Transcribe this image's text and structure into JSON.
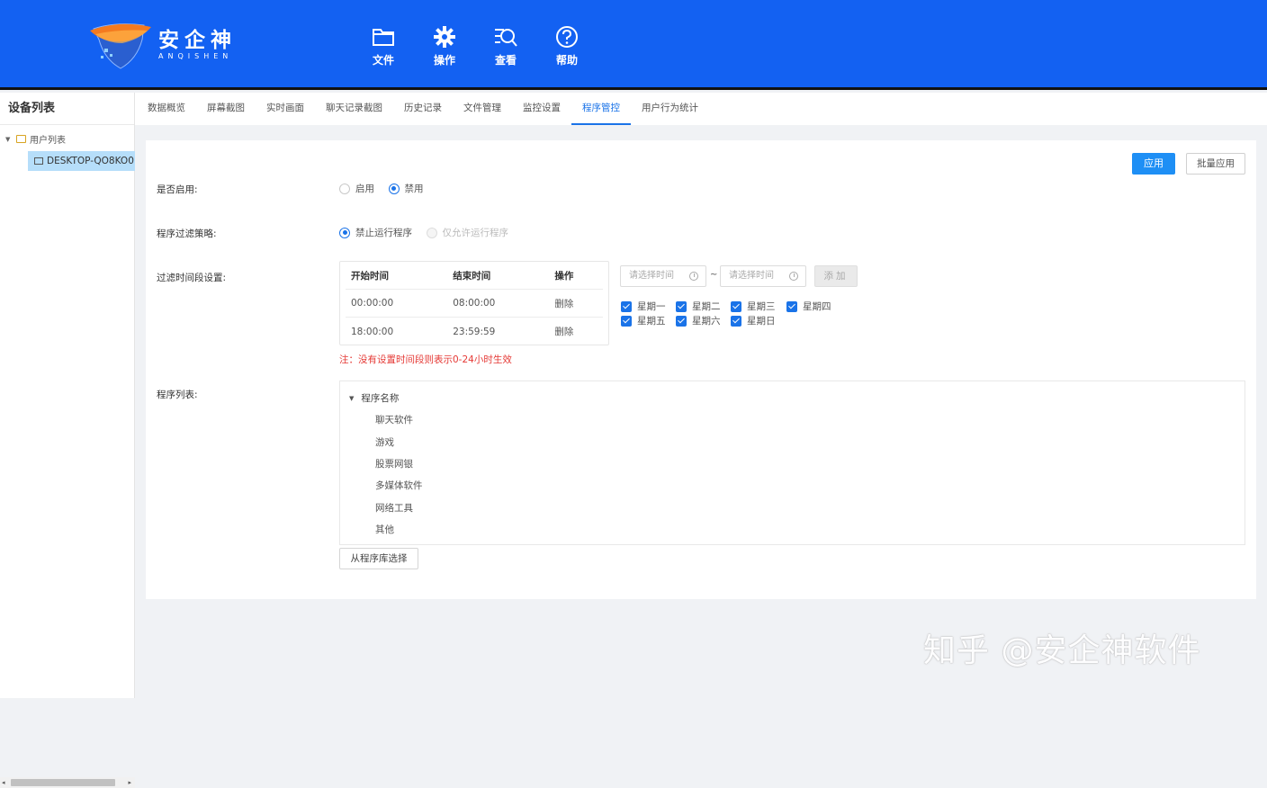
{
  "brand": {
    "name_cn": "安企神",
    "name_en": "ANQISHEN"
  },
  "topnav": [
    {
      "icon": "folder-icon",
      "label": "文件"
    },
    {
      "icon": "gear-icon",
      "label": "操作"
    },
    {
      "icon": "search-list-icon",
      "label": "查看"
    },
    {
      "icon": "help-icon",
      "label": "帮助"
    }
  ],
  "sidebar": {
    "title": "设备列表",
    "root": "用户列表",
    "device": "DESKTOP-QO8KO0"
  },
  "tabs": [
    {
      "label": "数据概览"
    },
    {
      "label": "屏幕截图"
    },
    {
      "label": "实时画面"
    },
    {
      "label": "聊天记录截图"
    },
    {
      "label": "历史记录"
    },
    {
      "label": "文件管理"
    },
    {
      "label": "监控设置"
    },
    {
      "label": "程序管控",
      "active": true
    },
    {
      "label": "用户行为统计"
    }
  ],
  "actions": {
    "apply": "应用",
    "batch_apply": "批量应用"
  },
  "enable": {
    "label": "是否启用:",
    "options": [
      {
        "label": "启用",
        "checked": false
      },
      {
        "label": "禁用",
        "checked": true
      }
    ]
  },
  "policy": {
    "label": "程序过滤策略:",
    "options": [
      {
        "label": "禁止运行程序",
        "checked": true
      },
      {
        "label": "仅允许运行程序",
        "checked": false,
        "disabled": true
      }
    ]
  },
  "time_filter": {
    "label": "过滤时间段设置:",
    "columns": [
      "开始时间",
      "结束时间",
      "操作"
    ],
    "rows": [
      {
        "start": "00:00:00",
        "end": "08:00:00",
        "action": "删除"
      },
      {
        "start": "18:00:00",
        "end": "23:59:59",
        "action": "删除"
      }
    ],
    "start_placeholder": "请选择时间",
    "end_placeholder": "请选择时间",
    "separator": "~",
    "add_label": "添加",
    "days": [
      {
        "label": "星期一",
        "checked": true
      },
      {
        "label": "星期二",
        "checked": true
      },
      {
        "label": "星期三",
        "checked": true
      },
      {
        "label": "星期四",
        "checked": true
      },
      {
        "label": "星期五",
        "checked": true
      },
      {
        "label": "星期六",
        "checked": true
      },
      {
        "label": "星期日",
        "checked": true
      }
    ],
    "note": "注：没有设置时间段则表示0-24小时生效"
  },
  "program_list": {
    "label": "程序列表:",
    "root": "程序名称",
    "items": [
      "聊天软件",
      "游戏",
      "股票网银",
      "多媒体软件",
      "网络工具",
      "其他"
    ],
    "select_button": "从程序库选择"
  },
  "watermark": "知乎 @安企神软件",
  "colors": {
    "header": "#1361f2",
    "accent": "#1a73e8",
    "primary_button": "#1e8ff5",
    "note": "#e53935"
  }
}
